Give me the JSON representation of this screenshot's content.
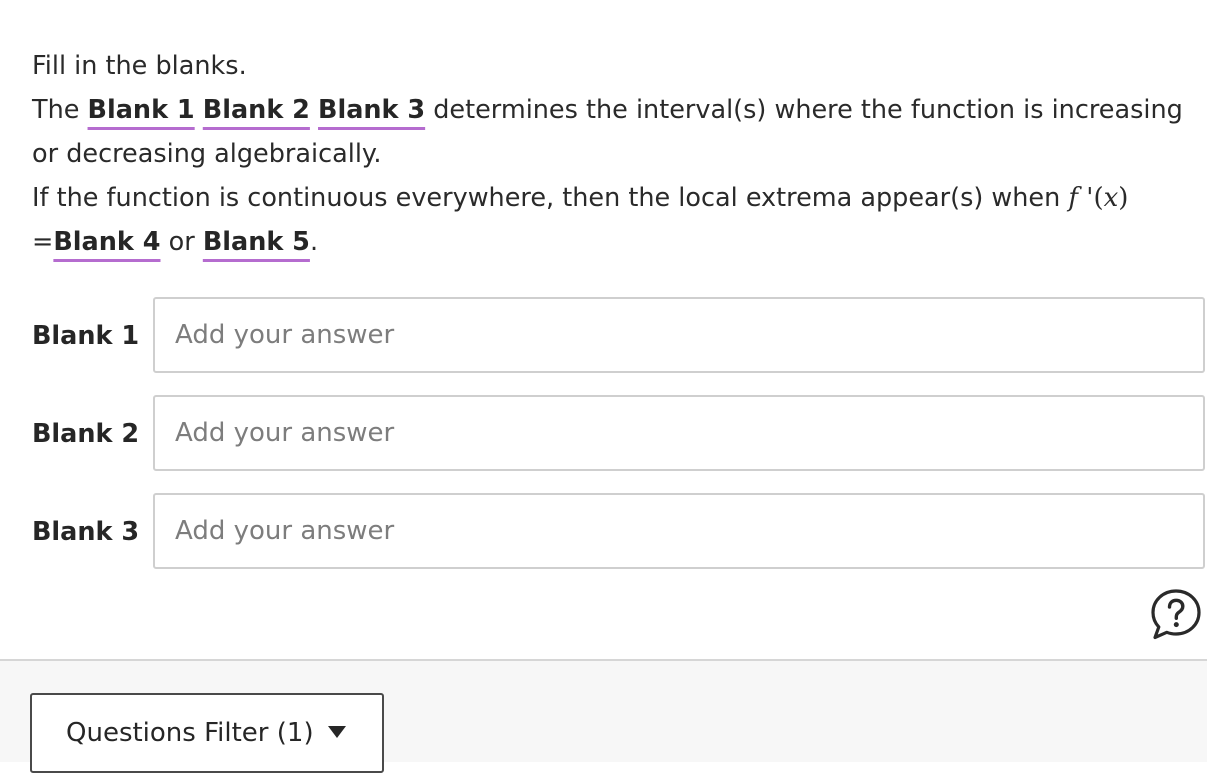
{
  "question": {
    "instruction": "Fill in the blanks.",
    "line1_prefix": "The",
    "line1_suffix": "determines the interval(s) where the function is increasing",
    "line2": "or decreasing algebraically.",
    "line3": "If the function is continuous everywhere, then the local extrema appear(s) when",
    "math_expr": {
      "func": "f",
      "prime": "'",
      "open": "(",
      "var": "x",
      "close": ")"
    },
    "line4_prefix": "=",
    "line4_or": "or",
    "line4_end": ".",
    "blank_refs": [
      "Blank 1",
      "Blank 2",
      "Blank 3",
      "Blank 4",
      "Blank 5"
    ]
  },
  "answers": [
    {
      "label": "Blank 1",
      "value": "",
      "placeholder": "Add your answer"
    },
    {
      "label": "Blank 2",
      "value": "",
      "placeholder": "Add your answer"
    },
    {
      "label": "Blank 3",
      "value": "",
      "placeholder": "Add your answer"
    }
  ],
  "help": {
    "icon": "question-speech-bubble-icon"
  },
  "footer": {
    "filter_label": "Questions Filter (1)",
    "filter_icon": "caret-down-icon"
  },
  "colors": {
    "blank_underline": "#b56ccf",
    "input_border": "#cfcfcf",
    "footer_bg": "#f7f7f7"
  }
}
